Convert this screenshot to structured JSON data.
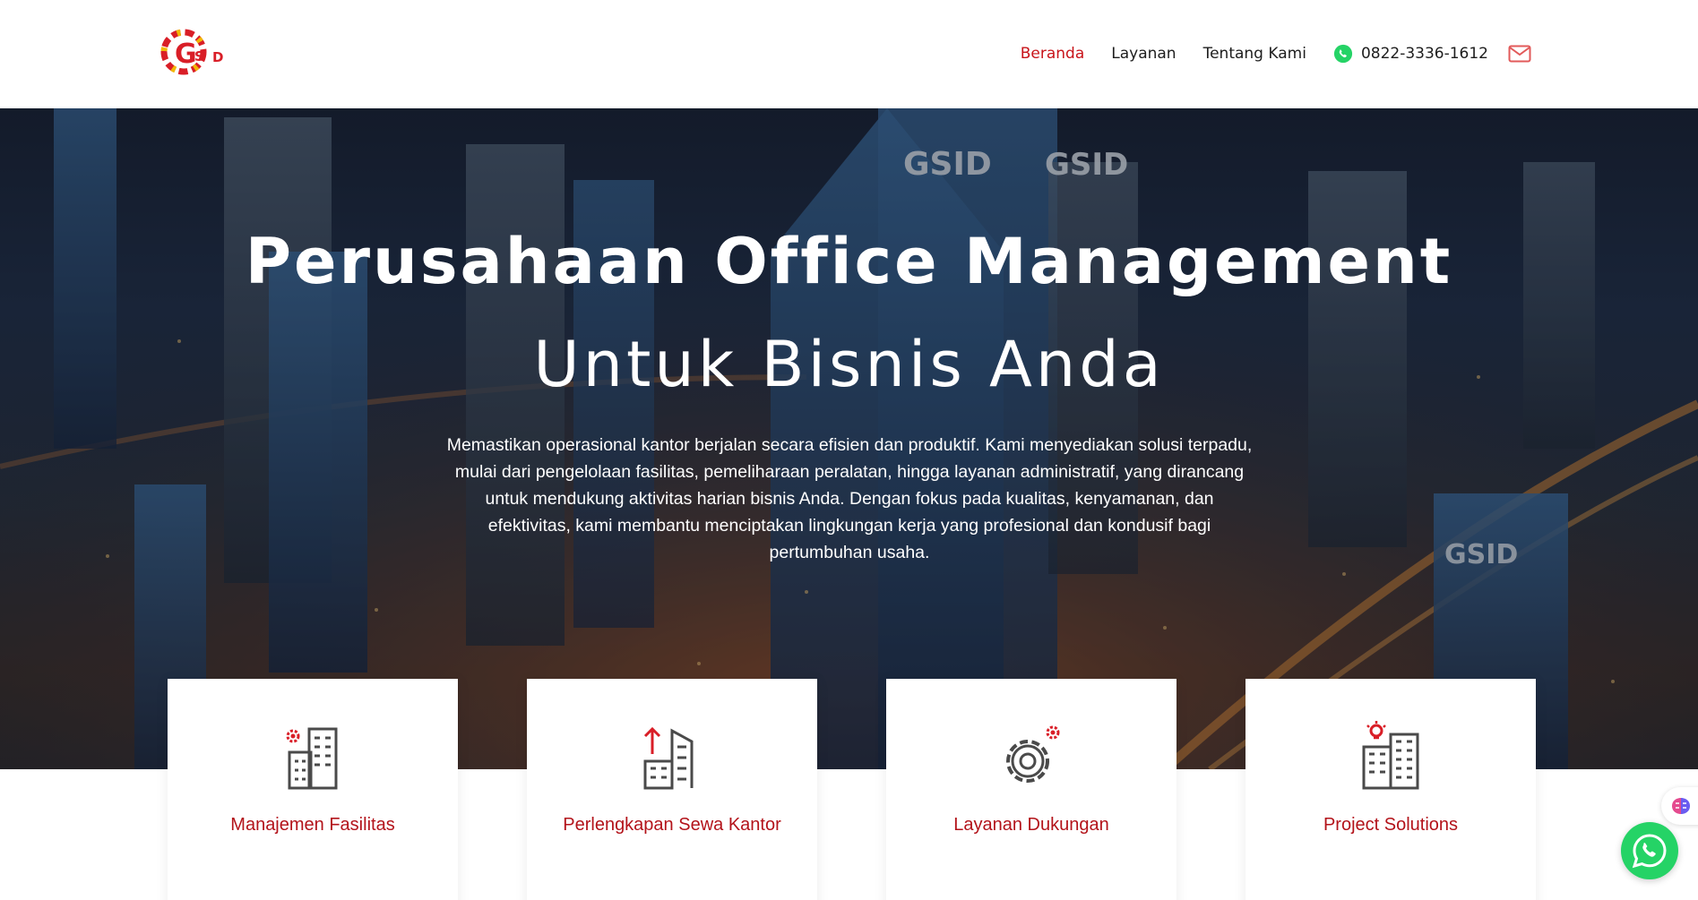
{
  "header": {
    "logo_icon": "gsid-logo-icon",
    "nav": [
      {
        "label": "Beranda",
        "active": true
      },
      {
        "label": "Layanan",
        "active": false
      },
      {
        "label": "Tentang Kami",
        "active": false
      }
    ],
    "phone": "0822-3336-1612",
    "phone_icon": "whatsapp-icon",
    "mail_icon": "mail-icon"
  },
  "hero": {
    "title": "Perusahaan Office Management",
    "subtitle": "Untuk Bisnis Anda",
    "description": "Memastikan operasional kantor berjalan secara efisien dan produktif. Kami menyediakan solusi terpadu, mulai dari pengelolaan fasilitas, pemeliharaan peralatan, hingga layanan administratif, yang dirancang untuk mendukung aktivitas harian bisnis Anda. Dengan fokus pada kualitas, kenyamanan, dan efektivitas, kami membantu menciptakan lingkungan kerja yang profesional dan kondusif bagi pertumbuhan usaha.",
    "background_signage": [
      "GSID",
      "GSID",
      "GSID"
    ]
  },
  "services": [
    {
      "label": "Manajemen Fasilitas",
      "icon": "building-gear-icon"
    },
    {
      "label": "Perlengkapan Sewa Kantor",
      "icon": "building-arrow-icon"
    },
    {
      "label": "Layanan Dukungan",
      "icon": "gear-icon"
    },
    {
      "label": "Project Solutions",
      "icon": "building-bulb-icon"
    }
  ],
  "floating": {
    "assistant_icon": "brain-icon",
    "whatsapp_icon": "whatsapp-chat-icon"
  },
  "colors": {
    "accent": "#c8141a",
    "card_label": "#b3131a",
    "icon_gray": "#4a4a4a",
    "whatsapp": "#25d366"
  }
}
